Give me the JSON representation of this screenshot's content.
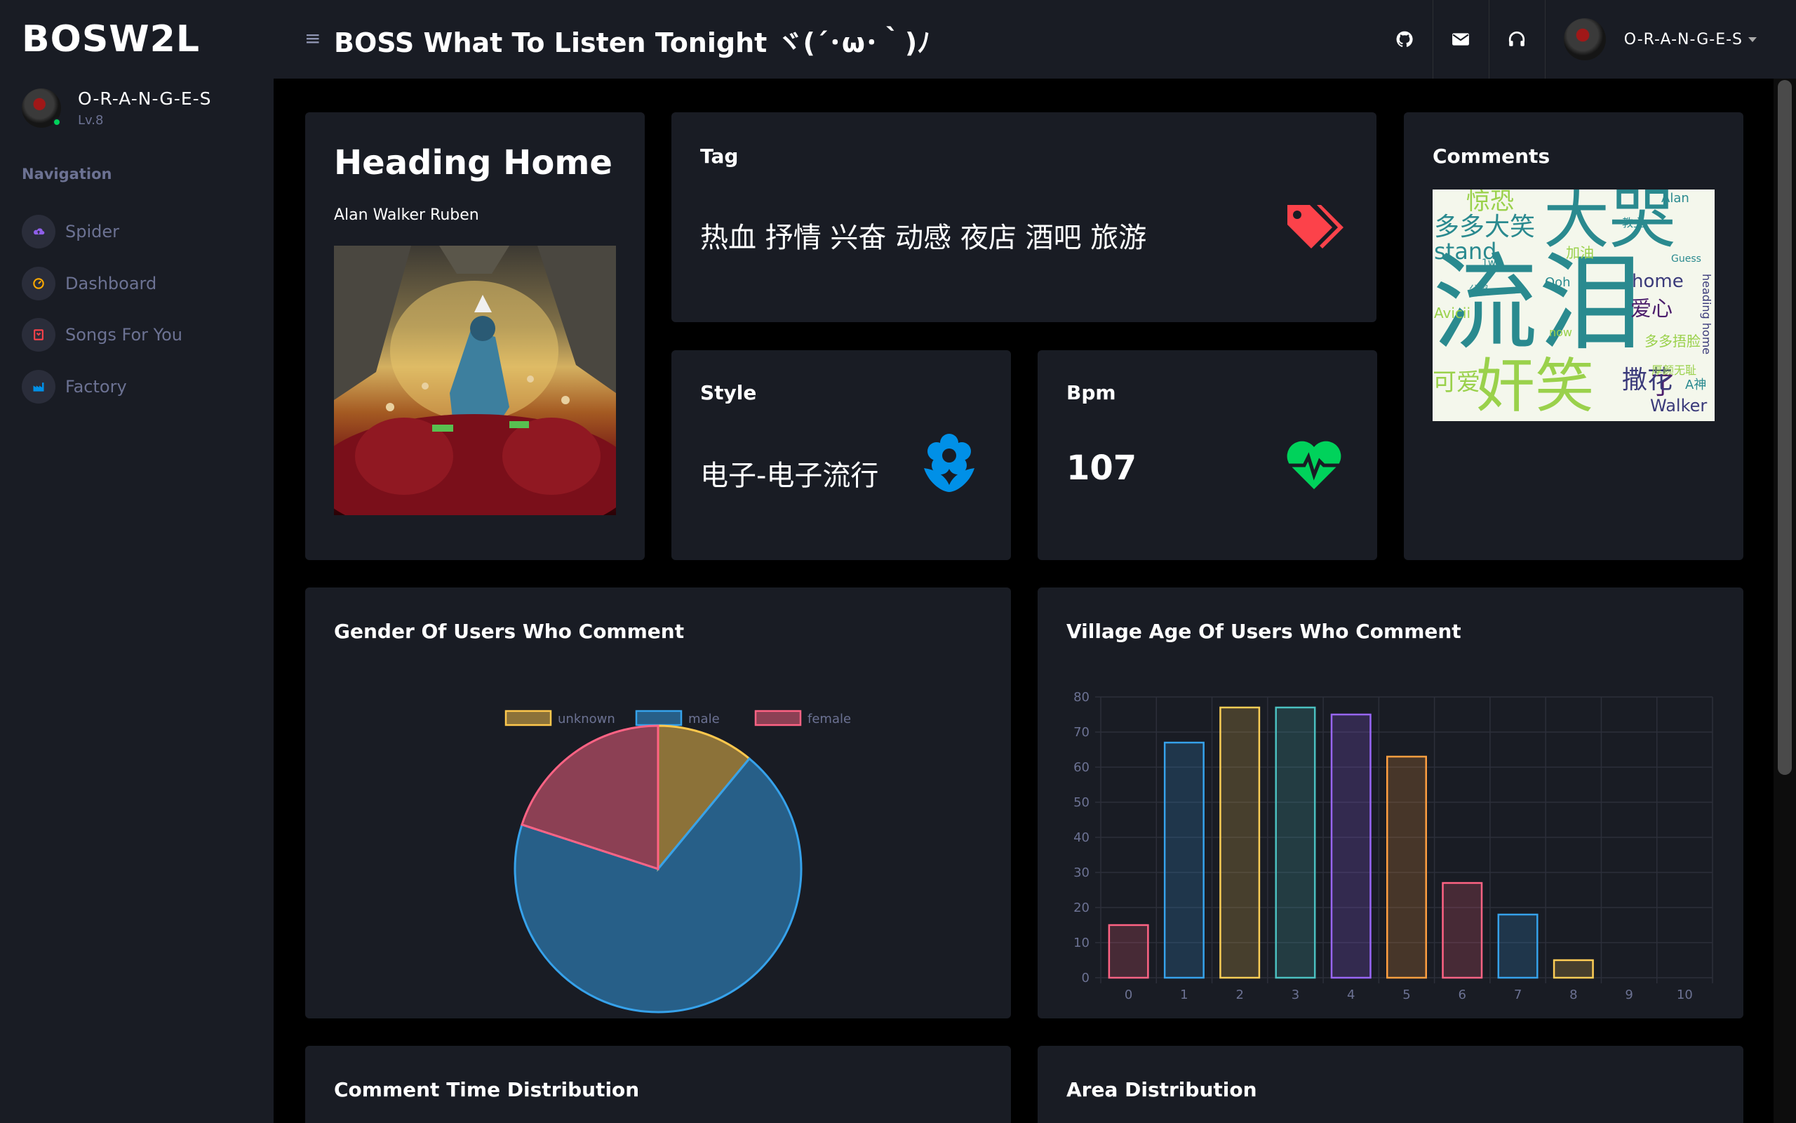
{
  "brand": "BOSW2L",
  "user": {
    "name": "O-R-A-N-G-E-S",
    "level": "Lv.8"
  },
  "sidebar": {
    "nav_title": "Navigation",
    "items": [
      {
        "label": "Spider",
        "icon": "cloud-upload-icon",
        "color": "#8f5fe8"
      },
      {
        "label": "Dashboard",
        "icon": "speedometer-icon",
        "color": "#ffab00"
      },
      {
        "label": "Songs For You",
        "icon": "playlist-icon",
        "color": "#fc424a"
      },
      {
        "label": "Factory",
        "icon": "factory-icon",
        "color": "#0090e7"
      }
    ]
  },
  "topbar": {
    "title": "BOSS What To Listen Tonight ヾ(´･ω･｀)ﾉ",
    "icons": [
      "github-icon",
      "mail-icon",
      "headphones-icon"
    ]
  },
  "song": {
    "title": "Heading Home",
    "artists": "Alan Walker Ruben"
  },
  "tag": {
    "title": "Tag",
    "value": "热血 抒情 兴奋 动感 夜店 酒吧 旅游",
    "icon": "tags-icon",
    "color": "#fc424a"
  },
  "style": {
    "title": "Style",
    "value": "电子-电子流行",
    "icon": "flower-icon",
    "color": "#0090e7"
  },
  "bpm": {
    "title": "Bpm",
    "value": "107",
    "icon": "heart-pulse-icon",
    "color": "#00d25b"
  },
  "comments": {
    "title": "Comments",
    "words": [
      {
        "text": "流泪",
        "color": "#2a8a8f"
      },
      {
        "text": "大哭",
        "color": "#2a8a8f"
      },
      {
        "text": "奸笑",
        "color": "#9ad14b"
      },
      {
        "text": "多多大笑",
        "color": "#2a8a8f"
      },
      {
        "text": "惊恐",
        "color": "#9ad14b"
      },
      {
        "text": "stand",
        "color": "#2a8a8f"
      },
      {
        "text": "home",
        "color": "#3a3a7a"
      },
      {
        "text": "爱心",
        "color": "#4b1d6b"
      },
      {
        "text": "Walker",
        "color": "#3a3a7a"
      },
      {
        "text": "可爱",
        "color": "#9ad14b"
      },
      {
        "text": "Alan",
        "color": "#2a8a8f"
      },
      {
        "text": "教主",
        "color": "#2a8a8f"
      },
      {
        "text": "加油",
        "color": "#9ad14b"
      },
      {
        "text": "Avicii",
        "color": "#9ad14b"
      },
      {
        "text": "heading home",
        "color": "#3a3a7a"
      },
      {
        "text": "了",
        "color": "#4b1d6b"
      },
      {
        "text": "撒花",
        "color": "#3a3a7a"
      },
      {
        "text": "多多捂脸",
        "color": "#9ad14b"
      },
      {
        "text": "A神",
        "color": "#2a8a8f"
      },
      {
        "text": "Ooh",
        "color": "#2a8a8f"
      },
      {
        "text": "Guess",
        "color": "#2a8a8f"
      },
      {
        "text": "now",
        "color": "#9ad14b"
      },
      {
        "text": "1w",
        "color": "#2a8a8f"
      },
      {
        "text": "厚颜无耻",
        "color": "#9ad14b"
      },
      {
        "text": "公鸡",
        "color": "#2a8a8f"
      }
    ]
  },
  "gender_chart": {
    "title": "Gender Of Users Who Comment",
    "chart_data": {
      "type": "pie",
      "categories": [
        "unknown",
        "male",
        "female"
      ],
      "values": [
        11,
        69,
        20
      ],
      "colors": [
        "#ffc84d",
        "#36a2eb",
        "#ff6384"
      ]
    }
  },
  "age_chart": {
    "title": "Village Age Of Users Who Comment",
    "chart_data": {
      "type": "bar",
      "categories": [
        "0",
        "1",
        "2",
        "3",
        "4",
        "5",
        "6",
        "7",
        "8",
        "9",
        "10"
      ],
      "values": [
        15,
        67,
        77,
        77,
        75,
        63,
        27,
        18,
        5,
        0,
        0
      ],
      "ylim": [
        0,
        80
      ],
      "yticks": [
        "0",
        "10",
        "20",
        "30",
        "40",
        "50",
        "60",
        "70",
        "80"
      ],
      "colors": [
        "#ff6384",
        "#36a2eb",
        "#ffce56",
        "#4bc0c0",
        "#9966ff",
        "#ff9f40",
        "#ff6384",
        "#36a2eb",
        "#ffce56",
        "#4bc0c0",
        "#9966ff"
      ],
      "grid": true
    }
  },
  "time_chart": {
    "title": "Comment Time Distribution"
  },
  "area_chart": {
    "title": "Area Distribution"
  }
}
